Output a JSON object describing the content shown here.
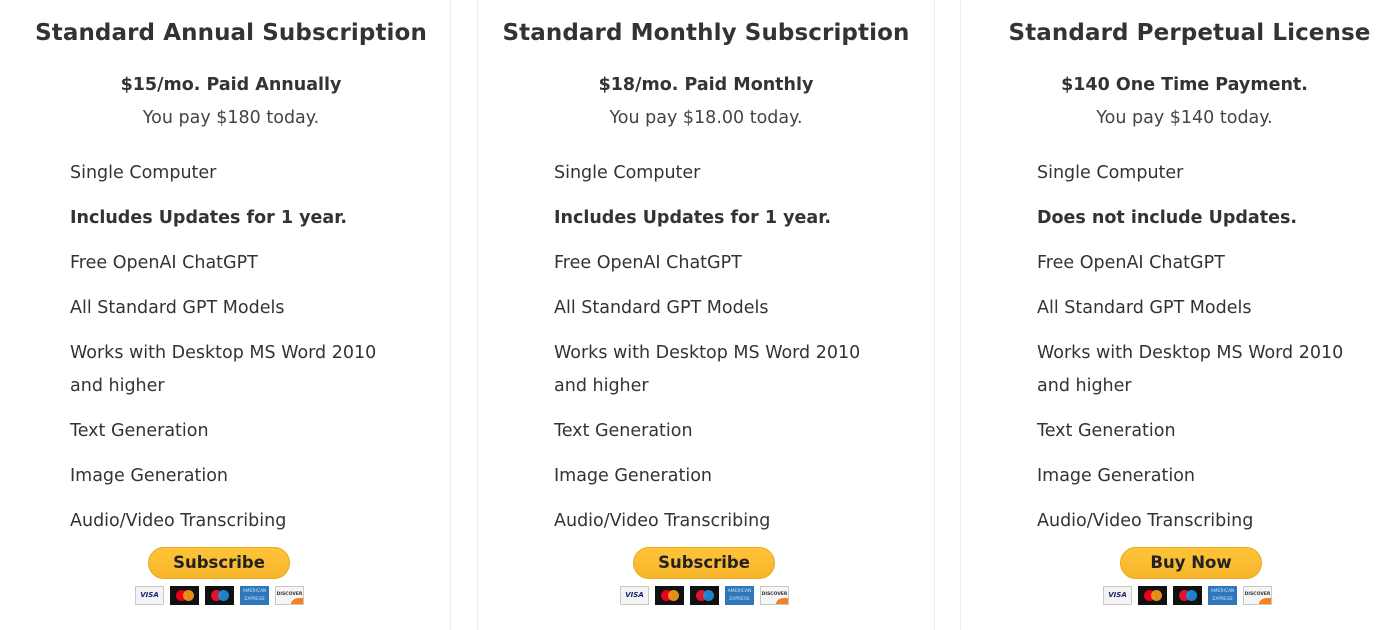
{
  "plans": [
    {
      "title": "Standard Annual Subscription",
      "price": "$15/mo. Paid Annually",
      "pay_today": "You pay $180 today.",
      "features": [
        {
          "text": "Single Computer",
          "bold": false
        },
        {
          "text": "Includes Updates for 1 year.",
          "bold": true
        },
        {
          "text": "Free OpenAI ChatGPT",
          "bold": false
        },
        {
          "text": "All Standard GPT Models",
          "bold": false
        },
        {
          "text": "Works with Desktop MS Word 2010 and higher",
          "bold": false
        },
        {
          "text": "Text Generation",
          "bold": false
        },
        {
          "text": "Image Generation",
          "bold": false
        },
        {
          "text": "Audio/Video Transcribing",
          "bold": false
        }
      ],
      "button_label": "Subscribe"
    },
    {
      "title": "Standard Monthly Subscription",
      "price": "$18/mo. Paid Monthly",
      "pay_today": "You pay $18.00 today.",
      "features": [
        {
          "text": "Single Computer",
          "bold": false
        },
        {
          "text": "Includes Updates for 1 year.",
          "bold": true
        },
        {
          "text": "Free OpenAI ChatGPT",
          "bold": false
        },
        {
          "text": "All Standard GPT Models",
          "bold": false
        },
        {
          "text": "Works with Desktop MS Word 2010 and higher",
          "bold": false
        },
        {
          "text": "Text Generation",
          "bold": false
        },
        {
          "text": "Image Generation",
          "bold": false
        },
        {
          "text": "Audio/Video Transcribing",
          "bold": false
        }
      ],
      "button_label": "Subscribe"
    },
    {
      "title": "Standard Perpetual License",
      "price": "$140 One Time Payment.",
      "pay_today": "You pay $140 today.",
      "features": [
        {
          "text": "Single Computer",
          "bold": false
        },
        {
          "text": "Does not include Updates.",
          "bold": true
        },
        {
          "text": "Free OpenAI ChatGPT",
          "bold": false
        },
        {
          "text": "All Standard GPT Models",
          "bold": false
        },
        {
          "text": "Works with Desktop MS Word 2010 and higher",
          "bold": false
        },
        {
          "text": "Text Generation",
          "bold": false
        },
        {
          "text": "Image Generation",
          "bold": false
        },
        {
          "text": "Audio/Video Transcribing",
          "bold": false
        }
      ],
      "button_label": "Buy Now"
    }
  ],
  "payment_cards": [
    "visa-icon",
    "mastercard-icon",
    "maestro-icon",
    "amex-icon",
    "discover-icon"
  ],
  "card_labels": {
    "visa": "VISA",
    "amex": "AMERICAN EXPRESS",
    "discover": "DISCOVER"
  },
  "colors": {
    "button": "#ffc439",
    "text": "#333333",
    "divider": "#ececec"
  }
}
